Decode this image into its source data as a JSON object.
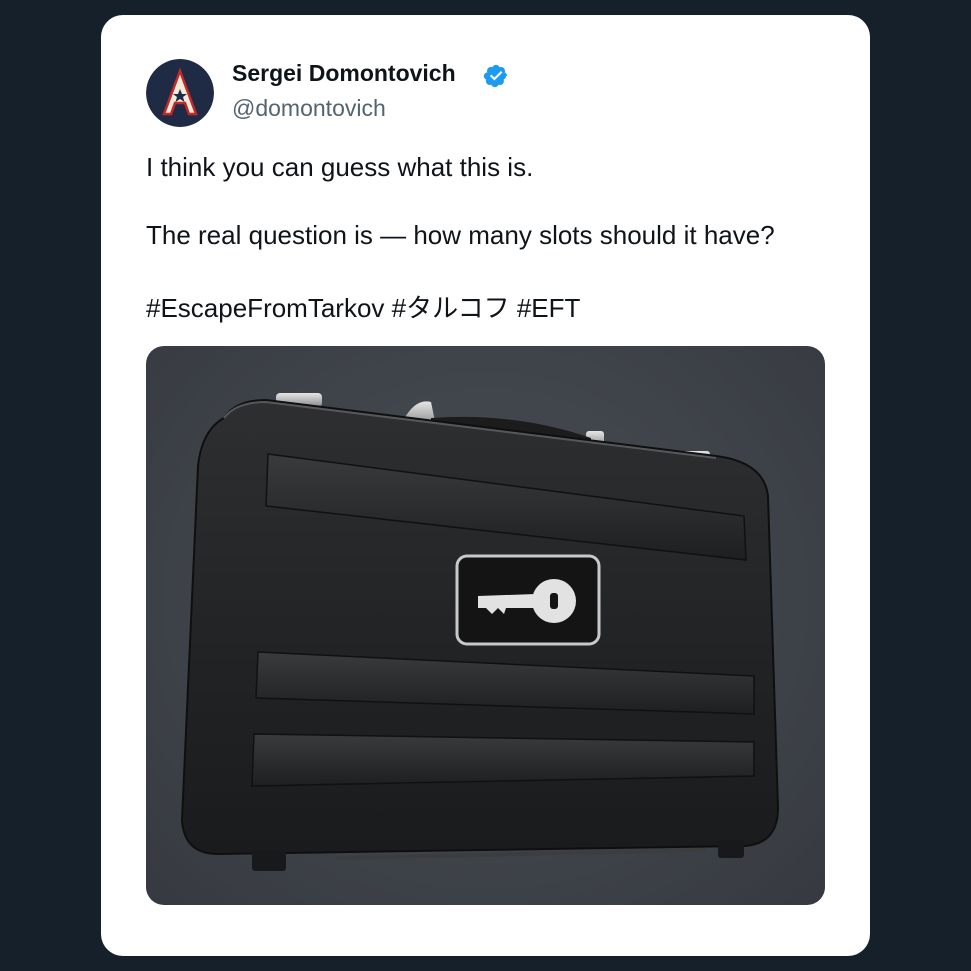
{
  "tweet": {
    "author": {
      "name": "Sergei Domontovich",
      "handle": "@domontovich",
      "verified": true,
      "avatar_icon": "avatar-letter-a-star"
    },
    "text": {
      "line1": "I think you can guess what this is.",
      "line2": "The real question is — how many slots should it have?",
      "hashtags": [
        "#EscapeFromTarkov",
        "#タルコフ",
        "#EFT"
      ]
    },
    "media": {
      "image_icon": "black-briefcase-with-key-emblem"
    },
    "colors": {
      "background": "#15202b",
      "card": "#ffffff",
      "name": "#0f1419",
      "handle": "#536471",
      "verified": "#1d9bf0"
    }
  }
}
